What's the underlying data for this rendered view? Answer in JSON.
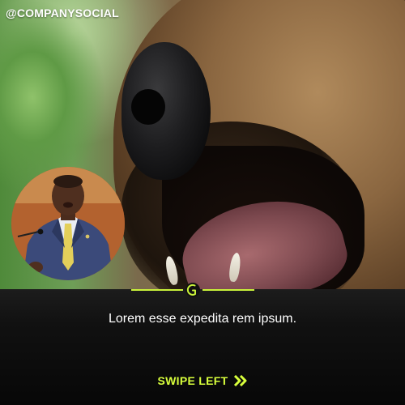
{
  "post": {
    "handle": "@COMPANYSOCIAL",
    "caption": "Lorem esse expedita rem ipsum.",
    "swipe_label": "SWIPE LEFT",
    "swipe_icon": "double-chevron-right-icon",
    "divider_icon": "brand-mark-icon",
    "background_image": "dog-closeup-photo",
    "inset_image": "man-in-suit-portrait",
    "accent_color": "#c9f23a",
    "panel_color": "#111111"
  }
}
